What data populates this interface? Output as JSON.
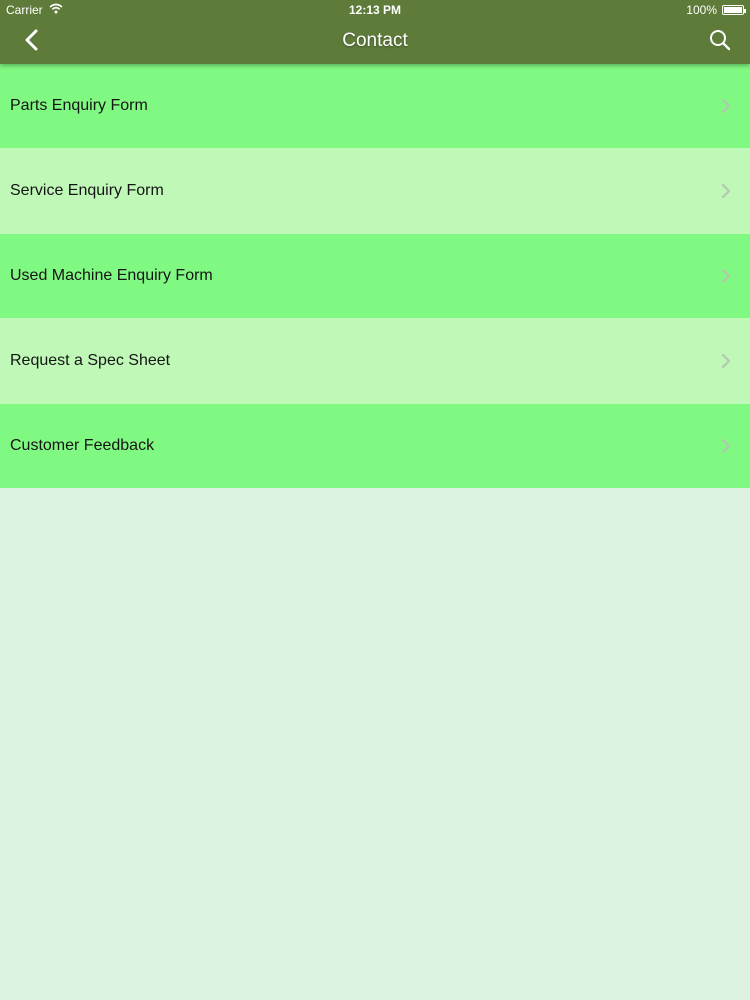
{
  "status_bar": {
    "carrier": "Carrier",
    "time": "12:13 PM",
    "battery": "100%"
  },
  "nav": {
    "title": "Contact"
  },
  "icons": {
    "back": "chevron-left-icon",
    "search": "search-icon",
    "wifi": "wifi-icon",
    "battery": "battery-icon",
    "row_arrow": "chevron-right-icon"
  },
  "colors": {
    "nav_background": "#5e7b3a",
    "row_dark": "#80f982",
    "row_light": "#bff8b7",
    "page_background": "#def3df",
    "chevron": "#b0c9ad"
  },
  "menu": {
    "items": [
      {
        "label": "Parts Enquiry Form"
      },
      {
        "label": "Service Enquiry Form"
      },
      {
        "label": "Used Machine Enquiry Form"
      },
      {
        "label": "Request a Spec Sheet"
      },
      {
        "label": "Customer Feedback"
      }
    ]
  }
}
